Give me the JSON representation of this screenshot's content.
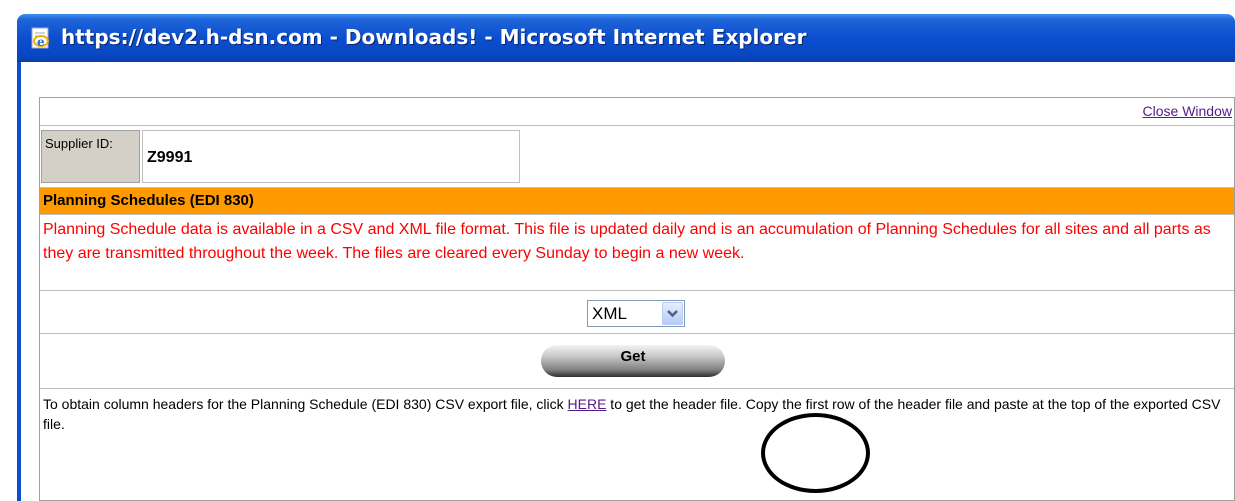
{
  "window": {
    "title": "https://dev2.h-dsn.com - Downloads! - Microsoft Internet Explorer"
  },
  "page": {
    "close_link": "Close Window",
    "supplier": {
      "label": "Supplier ID:",
      "value": "Z9991"
    },
    "section_title": "Planning Schedules (EDI 830)",
    "description": "Planning Schedule data is available in a CSV and XML file format. This file is updated daily and is an accumulation of Planning Schedules for all sites and all parts as they are transmitted throughout the week. The files are cleared every Sunday to begin a new week.",
    "format_select": {
      "value": "XML"
    },
    "get_button": "Get",
    "info": {
      "before": "To obtain column headers for the Planning Schedule (EDI 830) CSV export file, click ",
      "link": "HERE",
      "after": " to get the header file. Copy the first row of the header file and paste at the top of the exported CSV file."
    }
  },
  "colors": {
    "heading_bg": "#ff9900",
    "description_text": "#ff0000",
    "link": "#551a8b",
    "titlebar": "#0b4fd0"
  }
}
